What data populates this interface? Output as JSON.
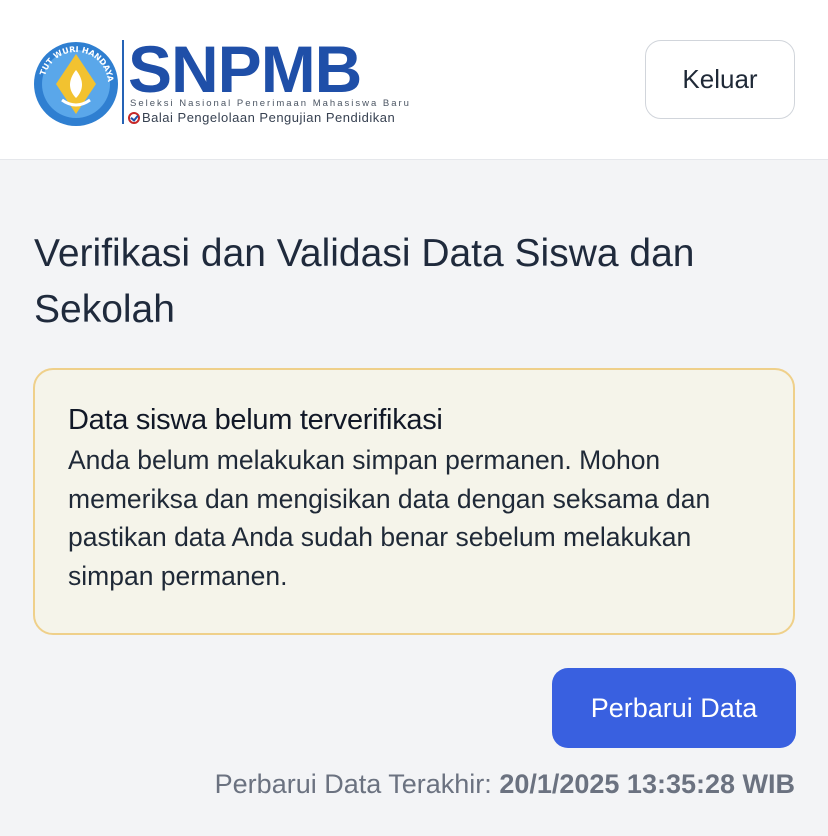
{
  "header": {
    "logo": {
      "brand": "SNPMB",
      "tagline": "Seleksi Nasional Penerimaan Mahasiswa Baru",
      "agency": "Balai Pengelolaan Pengujian Pendidikan",
      "emblem_text": "TUT WURI HANDAYANI"
    },
    "logout_label": "Keluar"
  },
  "page": {
    "title": "Verifikasi dan Validasi Data Siswa dan Sekolah"
  },
  "alert": {
    "title": "Data siswa belum terverifikasi",
    "body": "Anda belum melakukan simpan permanen. Mohon memeriksa dan mengisikan data dengan seksama dan pastikan data Anda sudah benar sebelum melakukan simpan permanen."
  },
  "actions": {
    "update_label": "Perbarui Data"
  },
  "last_update": {
    "label": "Perbarui Data Terakhir:",
    "timestamp": "20/1/2025 13:35:28 WIB"
  },
  "colors": {
    "primary": "#3960e0",
    "brand_blue": "#1f4fa8",
    "alert_bg": "#f5f4ea",
    "alert_border": "#efd08a"
  }
}
